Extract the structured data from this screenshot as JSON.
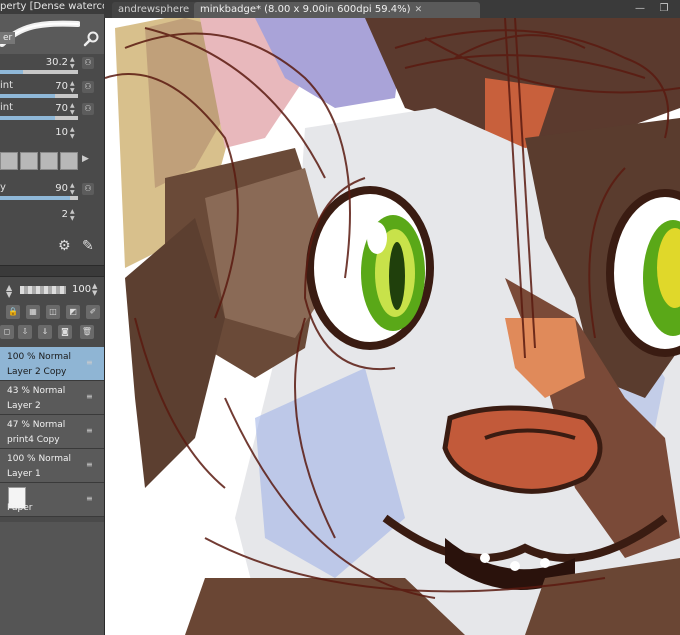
{
  "tool_property": {
    "title": "perty [Dense watercolo",
    "brush_tag": "er",
    "params": [
      {
        "label": "",
        "value": "30.2"
      },
      {
        "label": "int",
        "value": "70"
      },
      {
        "label": "int",
        "value": "70"
      },
      {
        "label": "",
        "value": "10"
      },
      {
        "label": "y",
        "value": "90"
      },
      {
        "label": "",
        "value": "2"
      }
    ]
  },
  "layers": {
    "opacity": "100",
    "items": [
      {
        "mode": "100 % Normal",
        "name": "Layer 2 Copy",
        "selected": true
      },
      {
        "mode": "43 % Normal",
        "name": "Layer 2",
        "selected": false
      },
      {
        "mode": "47 % Normal",
        "name": "print4 Copy",
        "selected": false
      },
      {
        "mode": "100 % Normal",
        "name": "Layer 1",
        "selected": false
      },
      {
        "mode": "",
        "name": "Paper",
        "selected": false
      }
    ]
  },
  "tabs": [
    {
      "label": "andrewsphere",
      "active": false
    },
    {
      "label": "minkbadge* (8.00 x 9.00in 600dpi 59.4%)",
      "active": true
    }
  ],
  "canvas": {
    "artwork": "Digital painting of a cat face with green eyes"
  }
}
